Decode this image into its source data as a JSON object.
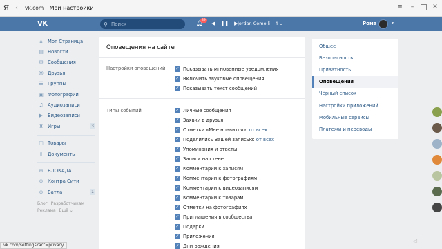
{
  "browser": {
    "yandex_button": "Я",
    "url_domain": "vk.com",
    "page_title": "Мои настройки",
    "status_url": "vk.com/settings?act=privacy"
  },
  "header": {
    "search_placeholder": "Поиск",
    "notifications_count": "39",
    "track": "Jordan Comolli – 4 U",
    "user_name": "Рома"
  },
  "sidebar": {
    "items": [
      {
        "label": "Моя Страница",
        "icon": "home-icon"
      },
      {
        "label": "Новости",
        "icon": "news-icon"
      },
      {
        "label": "Сообщения",
        "icon": "messages-icon"
      },
      {
        "label": "Друзья",
        "icon": "friends-icon"
      },
      {
        "label": "Группы",
        "icon": "groups-icon"
      },
      {
        "label": "Фотографии",
        "icon": "photos-icon"
      },
      {
        "label": "Аудиозаписи",
        "icon": "audio-icon"
      },
      {
        "label": "Видеозаписи",
        "icon": "video-icon"
      },
      {
        "label": "Игры",
        "icon": "games-icon",
        "count": "3"
      }
    ],
    "items2": [
      {
        "label": "Товары",
        "icon": "goods-icon"
      },
      {
        "label": "Документы",
        "icon": "docs-icon"
      }
    ],
    "items3": [
      {
        "label": "БЛОКАДА",
        "icon": "app-icon"
      },
      {
        "label": "Контра Сити",
        "icon": "app-icon"
      },
      {
        "label": "Батла",
        "icon": "app-icon",
        "count": "1"
      }
    ],
    "footer": {
      "blog": "Блог",
      "developers": "Разработчикам",
      "ads": "Реклама",
      "more": "Ещё ⌄"
    }
  },
  "main": {
    "title": "Оповещения на сайте",
    "settings_label": "Настройки оповещений",
    "settings_options": [
      "Показывать мгновенные уведомления",
      "Включить звуковые оповещения",
      "Показывать текст сообщений"
    ],
    "types_label": "Типы событий",
    "types_options": [
      {
        "label": "Личные сообщения"
      },
      {
        "label": "Заявки в друзья"
      },
      {
        "label": "Отметки «Мне нравится»:",
        "sub": "от всех"
      },
      {
        "label": "Поделились Вашей записью:",
        "sub": "от всех"
      },
      {
        "label": "Упоминания и ответы"
      },
      {
        "label": "Записи на стене"
      },
      {
        "label": "Комментарии к записям"
      },
      {
        "label": "Комментарии к фотографиям"
      },
      {
        "label": "Комментарии к видеозаписям"
      },
      {
        "label": "Комментарии к товарам"
      },
      {
        "label": "Отметки на фотографиях"
      },
      {
        "label": "Приглашения в сообщества"
      },
      {
        "label": "Подарки"
      },
      {
        "label": "Приложения"
      },
      {
        "label": "Дни рождения"
      }
    ]
  },
  "right_menu": {
    "items": [
      {
        "label": "Общее"
      },
      {
        "label": "Безопасность"
      },
      {
        "label": "Приватность"
      },
      {
        "label": "Оповещения",
        "active": true
      },
      {
        "label": "Чёрный список"
      },
      {
        "label": "Настройки приложений"
      },
      {
        "label": "Мобильные сервисы"
      },
      {
        "label": "Платежи и переводы"
      }
    ]
  },
  "colors": {
    "header_bg": "#4a76a8",
    "accent": "#5181b8",
    "link": "#2a5885",
    "page_bg": "#edeef0"
  }
}
